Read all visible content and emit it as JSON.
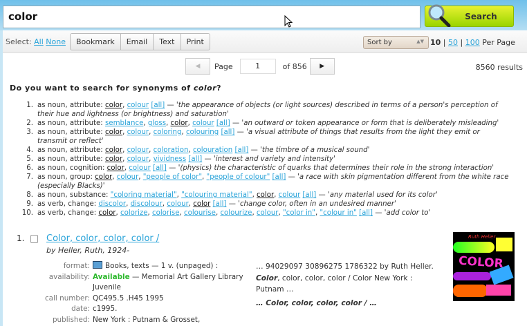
{
  "search": {
    "value": "color",
    "button": "Search"
  },
  "toolbar": {
    "select_label": "Select:",
    "all": "All",
    "none": "None",
    "bookmark": "Bookmark",
    "email": "Email",
    "text": "Text",
    "print": "Print",
    "sort": "Sort by",
    "per_page": [
      "10",
      "50",
      "100"
    ],
    "per_page_label": "Per Page"
  },
  "pager": {
    "page_label": "Page",
    "page": "1",
    "of": "of 856",
    "results": "8560 results"
  },
  "synonyms": {
    "heading_pre": "Do you want to search for synonyms of ",
    "term": "color",
    "heading_post": "?",
    "items": [
      {
        "num": "1.",
        "pos": "as noun, attribute:",
        "links": [
          {
            "t": "color",
            "c": true
          },
          {
            "t": "colour"
          }
        ],
        "def": "'the appearance of objects (or light sources) described in terms of a person's perception of their hue and lightness (or brightness) and saturation'"
      },
      {
        "num": "2.",
        "pos": "as noun, attribute:",
        "links": [
          {
            "t": "semblance"
          },
          {
            "t": "gloss"
          },
          {
            "t": "color",
            "c": true
          },
          {
            "t": "colour"
          }
        ],
        "def": "'an outward or token appearance or form that is deliberately misleading'"
      },
      {
        "num": "3.",
        "pos": "as noun, attribute:",
        "links": [
          {
            "t": "color",
            "c": true
          },
          {
            "t": "colour"
          },
          {
            "t": "coloring"
          },
          {
            "t": "colouring"
          }
        ],
        "def": "'a visual attribute of things that results from the light they emit or transmit or reflect'"
      },
      {
        "num": "4.",
        "pos": "as noun, attribute:",
        "links": [
          {
            "t": "color",
            "c": true
          },
          {
            "t": "colour"
          },
          {
            "t": "coloration"
          },
          {
            "t": "colouration"
          }
        ],
        "def": "'the timbre of a musical sound'"
      },
      {
        "num": "5.",
        "pos": "as noun, attribute:",
        "links": [
          {
            "t": "color",
            "c": true
          },
          {
            "t": "colour"
          },
          {
            "t": "vividness"
          }
        ],
        "def": "'interest and variety and intensity'"
      },
      {
        "num": "6.",
        "pos": "as noun, cognition:",
        "links": [
          {
            "t": "color",
            "c": true
          },
          {
            "t": "colour"
          }
        ],
        "def": "'(physics) the characteristic of quarks that determines their role in the strong interaction'"
      },
      {
        "num": "7.",
        "pos": "as noun, group:",
        "links": [
          {
            "t": "color",
            "c": true
          },
          {
            "t": "colour"
          },
          {
            "t": "\"people of color\""
          },
          {
            "t": "\"people of colour\""
          }
        ],
        "def": "'a race with skin pigmentation different from the white race (especially Blacks)'"
      },
      {
        "num": "8.",
        "pos": "as noun, substance:",
        "links": [
          {
            "t": "\"coloring material\""
          },
          {
            "t": "\"colouring material\""
          },
          {
            "t": "color",
            "c": true
          },
          {
            "t": "colour"
          }
        ],
        "def": "'any material used for its color'"
      },
      {
        "num": "9.",
        "pos": "as verb, change:",
        "links": [
          {
            "t": "discolor"
          },
          {
            "t": "discolour"
          },
          {
            "t": "colour"
          },
          {
            "t": "color",
            "c": true
          }
        ],
        "def": "'change color, often in an undesired manner'"
      },
      {
        "num": "10.",
        "pos": "as verb, change:",
        "links": [
          {
            "t": "color",
            "c": true
          },
          {
            "t": "colorize"
          },
          {
            "t": "colorise"
          },
          {
            "t": "colourise"
          },
          {
            "t": "colourize"
          },
          {
            "t": "colour"
          },
          {
            "t": "\"color in\""
          },
          {
            "t": "\"colour in\""
          }
        ],
        "def": "'add color to'"
      }
    ],
    "all_label": "[all]",
    "dash": " — "
  },
  "result": {
    "num": "1.",
    "title": "Color, color, color, color /",
    "author": "by Heller, Ruth, 1924-",
    "fields": {
      "format_label": "format:",
      "format": "Books, texts — 1 v. (unpaged) :",
      "availability_label": "availability:",
      "available": "Available",
      "location": " — Memorial Art Gallery Library Juvenile",
      "call_label": "call number:",
      "call": "QC495.5 .H45 1995",
      "date_label": "date:",
      "date": "c1995.",
      "published_label": "published:",
      "published": "New York : Putnam & Grosset,"
    },
    "snippet1": "… 94029097 30896275 1786322 by Ruth Heller. ",
    "snippet1_bold": "Color",
    "snippet1_rest": ", color, color, color / Color New York : Putnam …",
    "snippet2": "… Color, color, color, color / …",
    "cover_title": "COLOR",
    "cover_author": "Ruth Heller"
  }
}
